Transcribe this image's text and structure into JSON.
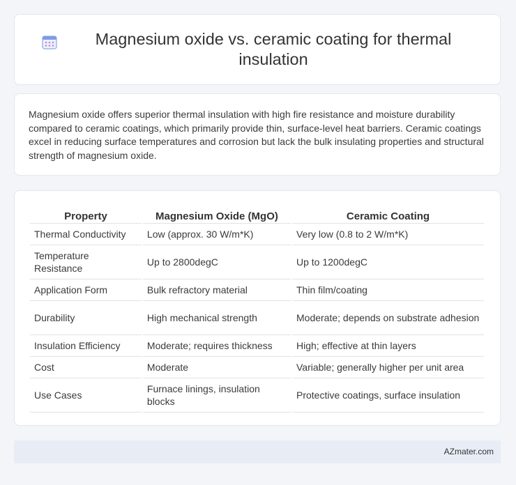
{
  "header": {
    "title": "Magnesium oxide vs. ceramic coating for thermal insulation",
    "icon": "calendar-icon"
  },
  "summary": {
    "text": "Magnesium oxide offers superior thermal insulation with high fire resistance and moisture durability compared to ceramic coatings, which primarily provide thin, surface-level heat barriers. Ceramic coatings excel in reducing surface temperatures and corrosion but lack the bulk insulating properties and structural strength of magnesium oxide."
  },
  "table": {
    "headers": [
      "Property",
      "Magnesium Oxide (MgO)",
      "Ceramic Coating"
    ],
    "rows": [
      [
        "Thermal Conductivity",
        "Low (approx. 30 W/m*K)",
        "Very low (0.8 to 2 W/m*K)"
      ],
      [
        "Temperature Resistance",
        "Up to 2800degC",
        "Up to 1200degC"
      ],
      [
        "Application Form",
        "Bulk refractory material",
        "Thin film/coating"
      ],
      [
        "Durability",
        "High mechanical strength",
        "Moderate; depends on substrate adhesion"
      ],
      [
        "Insulation Efficiency",
        "Moderate; requires thickness",
        "High; effective at thin layers"
      ],
      [
        "Cost",
        "Moderate",
        "Variable; generally higher per unit area"
      ],
      [
        "Use Cases",
        "Furnace linings, insulation blocks",
        "Protective coatings, surface insulation"
      ]
    ]
  },
  "footer": {
    "brand": "AZmater.com"
  },
  "colors": {
    "background": "#f3f5f9",
    "footer_bg": "#e8edf5",
    "icon_accent": "#6b8de3"
  }
}
